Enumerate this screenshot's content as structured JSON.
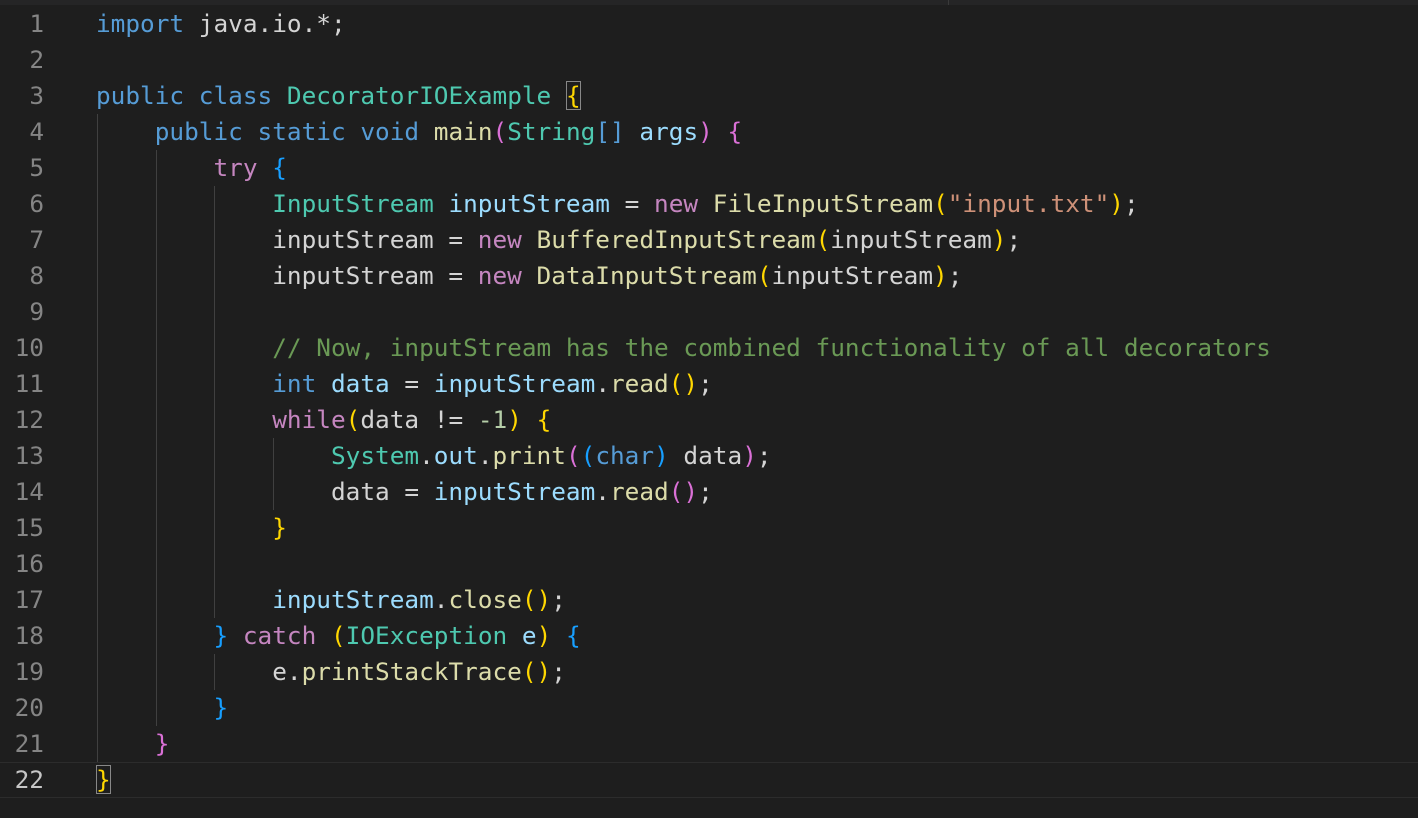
{
  "theme": {
    "background": "#1e1e1e",
    "line_number": "#858585",
    "keyword": "#569cd6",
    "control": "#c586c0",
    "type": "#4ec9b0",
    "variable": "#9cdcfe",
    "function": "#dcdcaa",
    "string": "#ce9178",
    "comment": "#6a9955",
    "bracket_level_1": "#ffd700",
    "bracket_level_2": "#da70d6",
    "bracket_level_3": "#179fff"
  },
  "editor": {
    "language": "java",
    "current_line": 22,
    "lines": [
      {
        "number": "1",
        "tokens": [
          {
            "t": "keyword",
            "v": "import"
          },
          {
            "t": "plain",
            "v": " java.io.*;"
          }
        ]
      },
      {
        "number": "2",
        "tokens": []
      },
      {
        "number": "3",
        "tokens": [
          {
            "t": "keyword",
            "v": "public"
          },
          {
            "t": "plain",
            "v": " "
          },
          {
            "t": "keyword",
            "v": "class"
          },
          {
            "t": "plain",
            "v": " "
          },
          {
            "t": "type",
            "v": "DecoratorIOExample"
          },
          {
            "t": "plain",
            "v": " "
          },
          {
            "t": "b1",
            "v": "{",
            "m": true
          }
        ]
      },
      {
        "number": "4",
        "tokens": [
          {
            "t": "plain",
            "v": "    "
          },
          {
            "t": "keyword",
            "v": "public"
          },
          {
            "t": "plain",
            "v": " "
          },
          {
            "t": "keyword",
            "v": "static"
          },
          {
            "t": "plain",
            "v": " "
          },
          {
            "t": "keyword",
            "v": "void"
          },
          {
            "t": "plain",
            "v": " "
          },
          {
            "t": "func",
            "v": "main"
          },
          {
            "t": "b2",
            "v": "("
          },
          {
            "t": "type",
            "v": "String"
          },
          {
            "t": "keyword",
            "v": "[]"
          },
          {
            "t": "plain",
            "v": " "
          },
          {
            "t": "var",
            "v": "args"
          },
          {
            "t": "b2",
            "v": ")"
          },
          {
            "t": "plain",
            "v": " "
          },
          {
            "t": "b2",
            "v": "{"
          }
        ]
      },
      {
        "number": "5",
        "tokens": [
          {
            "t": "plain",
            "v": "        "
          },
          {
            "t": "control",
            "v": "try"
          },
          {
            "t": "plain",
            "v": " "
          },
          {
            "t": "b3",
            "v": "{"
          }
        ]
      },
      {
        "number": "6",
        "tokens": [
          {
            "t": "plain",
            "v": "            "
          },
          {
            "t": "type",
            "v": "InputStream"
          },
          {
            "t": "plain",
            "v": " "
          },
          {
            "t": "var",
            "v": "inputStream"
          },
          {
            "t": "plain",
            "v": " = "
          },
          {
            "t": "control",
            "v": "new"
          },
          {
            "t": "plain",
            "v": " "
          },
          {
            "t": "func",
            "v": "FileInputStream"
          },
          {
            "t": "b1",
            "v": "("
          },
          {
            "t": "string",
            "v": "\"input.txt\""
          },
          {
            "t": "b1",
            "v": ")"
          },
          {
            "t": "plain",
            "v": ";"
          }
        ]
      },
      {
        "number": "7",
        "tokens": [
          {
            "t": "plain",
            "v": "            inputStream = "
          },
          {
            "t": "control",
            "v": "new"
          },
          {
            "t": "plain",
            "v": " "
          },
          {
            "t": "func",
            "v": "BufferedInputStream"
          },
          {
            "t": "b1",
            "v": "("
          },
          {
            "t": "plain",
            "v": "inputStream"
          },
          {
            "t": "b1",
            "v": ")"
          },
          {
            "t": "plain",
            "v": ";"
          }
        ]
      },
      {
        "number": "8",
        "tokens": [
          {
            "t": "plain",
            "v": "            inputStream = "
          },
          {
            "t": "control",
            "v": "new"
          },
          {
            "t": "plain",
            "v": " "
          },
          {
            "t": "func",
            "v": "DataInputStream"
          },
          {
            "t": "b1",
            "v": "("
          },
          {
            "t": "plain",
            "v": "inputStream"
          },
          {
            "t": "b1",
            "v": ")"
          },
          {
            "t": "plain",
            "v": ";"
          }
        ]
      },
      {
        "number": "9",
        "tokens": []
      },
      {
        "number": "10",
        "tokens": [
          {
            "t": "plain",
            "v": "            "
          },
          {
            "t": "comment",
            "v": "// Now, inputStream has the combined functionality of all decorators"
          }
        ]
      },
      {
        "number": "11",
        "tokens": [
          {
            "t": "plain",
            "v": "            "
          },
          {
            "t": "keyword",
            "v": "int"
          },
          {
            "t": "plain",
            "v": " "
          },
          {
            "t": "var",
            "v": "data"
          },
          {
            "t": "plain",
            "v": " = "
          },
          {
            "t": "var",
            "v": "inputStream"
          },
          {
            "t": "plain",
            "v": "."
          },
          {
            "t": "func",
            "v": "read"
          },
          {
            "t": "b1",
            "v": "()"
          },
          {
            "t": "plain",
            "v": ";"
          }
        ]
      },
      {
        "number": "12",
        "tokens": [
          {
            "t": "plain",
            "v": "            "
          },
          {
            "t": "control",
            "v": "while"
          },
          {
            "t": "b1",
            "v": "("
          },
          {
            "t": "plain",
            "v": "data != "
          },
          {
            "t": "number",
            "v": "-1"
          },
          {
            "t": "b1",
            "v": ")"
          },
          {
            "t": "plain",
            "v": " "
          },
          {
            "t": "b1",
            "v": "{"
          }
        ]
      },
      {
        "number": "13",
        "tokens": [
          {
            "t": "plain",
            "v": "                "
          },
          {
            "t": "type",
            "v": "System"
          },
          {
            "t": "plain",
            "v": "."
          },
          {
            "t": "var",
            "v": "out"
          },
          {
            "t": "plain",
            "v": "."
          },
          {
            "t": "func",
            "v": "print"
          },
          {
            "t": "b2",
            "v": "("
          },
          {
            "t": "b3",
            "v": "("
          },
          {
            "t": "keyword",
            "v": "char"
          },
          {
            "t": "b3",
            "v": ")"
          },
          {
            "t": "plain",
            "v": " data"
          },
          {
            "t": "b2",
            "v": ")"
          },
          {
            "t": "plain",
            "v": ";"
          }
        ]
      },
      {
        "number": "14",
        "tokens": [
          {
            "t": "plain",
            "v": "                data = "
          },
          {
            "t": "var",
            "v": "inputStream"
          },
          {
            "t": "plain",
            "v": "."
          },
          {
            "t": "func",
            "v": "read"
          },
          {
            "t": "b2",
            "v": "()"
          },
          {
            "t": "plain",
            "v": ";"
          }
        ]
      },
      {
        "number": "15",
        "tokens": [
          {
            "t": "plain",
            "v": "            "
          },
          {
            "t": "b1",
            "v": "}"
          }
        ]
      },
      {
        "number": "16",
        "tokens": []
      },
      {
        "number": "17",
        "tokens": [
          {
            "t": "plain",
            "v": "            "
          },
          {
            "t": "var",
            "v": "inputStream"
          },
          {
            "t": "plain",
            "v": "."
          },
          {
            "t": "func",
            "v": "close"
          },
          {
            "t": "b1",
            "v": "()"
          },
          {
            "t": "plain",
            "v": ";"
          }
        ]
      },
      {
        "number": "18",
        "tokens": [
          {
            "t": "plain",
            "v": "        "
          },
          {
            "t": "b3",
            "v": "}"
          },
          {
            "t": "plain",
            "v": " "
          },
          {
            "t": "control",
            "v": "catch"
          },
          {
            "t": "plain",
            "v": " "
          },
          {
            "t": "b1",
            "v": "("
          },
          {
            "t": "type",
            "v": "IOException"
          },
          {
            "t": "plain",
            "v": " "
          },
          {
            "t": "var",
            "v": "e"
          },
          {
            "t": "b1",
            "v": ")"
          },
          {
            "t": "plain",
            "v": " "
          },
          {
            "t": "b3",
            "v": "{"
          }
        ]
      },
      {
        "number": "19",
        "tokens": [
          {
            "t": "plain",
            "v": "            e."
          },
          {
            "t": "func",
            "v": "printStackTrace"
          },
          {
            "t": "b1",
            "v": "()"
          },
          {
            "t": "plain",
            "v": ";"
          }
        ]
      },
      {
        "number": "20",
        "tokens": [
          {
            "t": "plain",
            "v": "        "
          },
          {
            "t": "b3",
            "v": "}"
          }
        ]
      },
      {
        "number": "21",
        "tokens": [
          {
            "t": "plain",
            "v": "    "
          },
          {
            "t": "b2",
            "v": "}"
          }
        ]
      },
      {
        "number": "22",
        "tokens": [
          {
            "t": "b1",
            "v": "}",
            "m": true
          }
        ]
      }
    ]
  }
}
